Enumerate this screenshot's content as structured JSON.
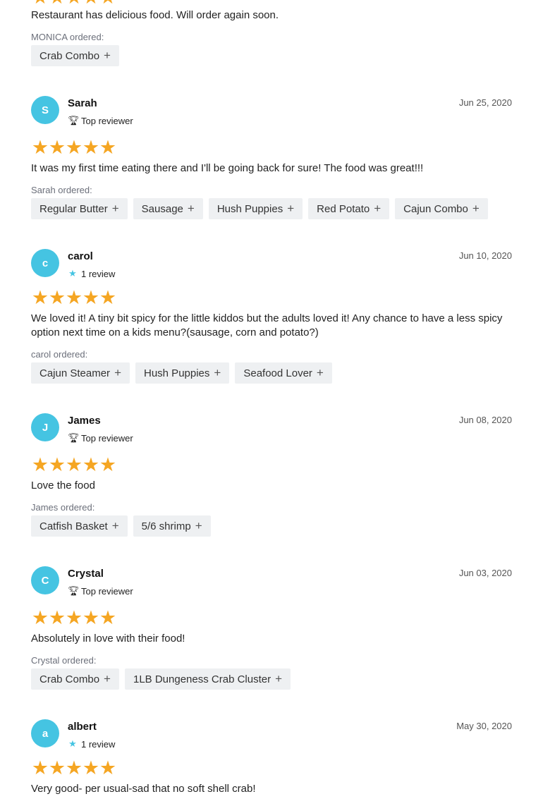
{
  "top_partial": {
    "text": "Restaurant has delicious food. Will order again soon.",
    "ordered_label": "MONICA ordered:",
    "items": [
      "Crab Combo"
    ]
  },
  "reviews": [
    {
      "initial": "S",
      "name": "Sarah",
      "badge": "Top reviewer",
      "badge_icon": "trophy-icon",
      "date": "Jun 25, 2020",
      "stars": 5,
      "text": "It was my first time eating there and I'll be going back for sure! The food was great!!!",
      "ordered_label": "Sarah ordered:",
      "items": [
        "Regular Butter",
        "Sausage",
        "Hush Puppies",
        "Red Potato",
        "Cajun Combo"
      ]
    },
    {
      "initial": "c",
      "name": "carol",
      "badge": "1 review",
      "badge_icon": "star-icon",
      "date": "Jun 10, 2020",
      "stars": 5,
      "text": "We loved it! A tiny bit spicy for the little kiddos but the adults loved it! Any chance to have a less spicy option next time on a kids menu?(sausage, corn and potato?)",
      "ordered_label": "carol ordered:",
      "items": [
        "Cajun Steamer",
        "Hush Puppies",
        "Seafood Lover"
      ]
    },
    {
      "initial": "J",
      "name": "James",
      "badge": "Top reviewer",
      "badge_icon": "trophy-icon",
      "date": "Jun 08, 2020",
      "stars": 5,
      "text": "Love the food",
      "ordered_label": "James ordered:",
      "items": [
        "Catfish Basket",
        "5/6 shrimp"
      ]
    },
    {
      "initial": "C",
      "name": "Crystal",
      "badge": "Top reviewer",
      "badge_icon": "trophy-icon",
      "date": "Jun 03, 2020",
      "stars": 5,
      "text": "Absolutely in love with their food!",
      "ordered_label": "Crystal ordered:",
      "items": [
        "Crab Combo",
        "1LB Dungeness Crab Cluster"
      ]
    },
    {
      "initial": "a",
      "name": "albert",
      "badge": "1 review",
      "badge_icon": "star-icon",
      "date": "May 30, 2020",
      "stars": 5,
      "text": "Very good- per usual-sad that no soft shell crab!"
    }
  ],
  "colors": {
    "star": "#f5a623",
    "avatar": "#45c4e2",
    "chip_bg": "#eef0f2"
  }
}
